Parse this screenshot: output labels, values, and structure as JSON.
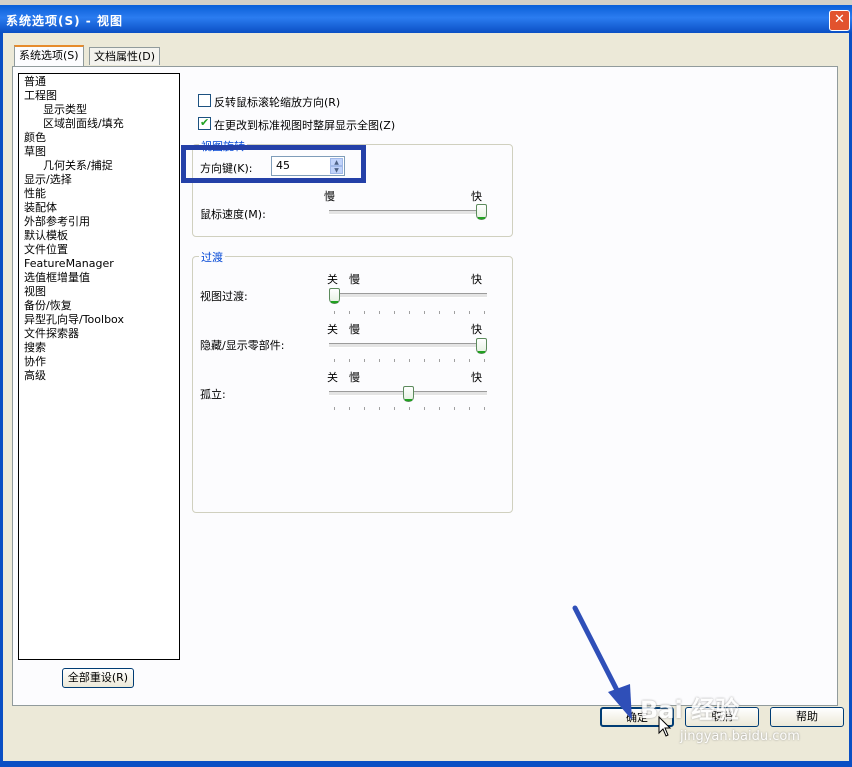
{
  "window": {
    "title": "系统选项(S) - 视图",
    "close_label": "✕"
  },
  "tabs": [
    {
      "label": "系统选项(S)",
      "active": true
    },
    {
      "label": "文档属性(D)",
      "active": false
    }
  ],
  "tree": {
    "items": [
      {
        "label": "普通",
        "level": 0
      },
      {
        "label": "工程图",
        "level": 0
      },
      {
        "label": "显示类型",
        "level": 1
      },
      {
        "label": "区域剖面线/填充",
        "level": 1
      },
      {
        "label": "颜色",
        "level": 0
      },
      {
        "label": "草图",
        "level": 0
      },
      {
        "label": "几何关系/捕捉",
        "level": 1
      },
      {
        "label": "显示/选择",
        "level": 0
      },
      {
        "label": "性能",
        "level": 0
      },
      {
        "label": "装配体",
        "level": 0
      },
      {
        "label": "外部参考引用",
        "level": 0
      },
      {
        "label": "默认模板",
        "level": 0
      },
      {
        "label": "文件位置",
        "level": 0
      },
      {
        "label": "FeatureManager",
        "level": 0
      },
      {
        "label": "选值框增量值",
        "level": 0
      },
      {
        "label": "视图",
        "level": 0
      },
      {
        "label": "备份/恢复",
        "level": 0
      },
      {
        "label": "异型孔向导/Toolbox",
        "level": 0
      },
      {
        "label": "文件探索器",
        "level": 0
      },
      {
        "label": "搜索",
        "level": 0
      },
      {
        "label": "协作",
        "level": 0
      },
      {
        "label": "高级",
        "level": 0
      }
    ],
    "reset_button": "全部重设(R)"
  },
  "options": {
    "reverse_wheel": {
      "label": "反转鼠标滚轮缩放方向(R)",
      "checked": false
    },
    "zoom_fit": {
      "label": "在更改到标准视图时整屏显示全图(Z)",
      "checked": true
    }
  },
  "view_rotation": {
    "group_title": "视图旋转",
    "arrow_keys_label": "方向键(K):",
    "arrow_keys_value": "45",
    "mouse_speed_label": "鼠标速度(M):",
    "slow": "慢",
    "fast": "快",
    "mouse_speed_level": 1.0
  },
  "transitions": {
    "group_title": "过渡",
    "off": "关",
    "slow": "慢",
    "fast": "快",
    "view_transition": {
      "label": "视图过渡:",
      "level": 0.0
    },
    "hide_show": {
      "label": "隐藏/显示零部件:",
      "level": 1.0
    },
    "isolate": {
      "label": "孤立:",
      "level": 0.5
    }
  },
  "footer": {
    "ok": "确定",
    "cancel": "取消",
    "help": "帮助"
  },
  "watermark": {
    "brand": "Bai 经验",
    "url": "jingyan.baidu.com"
  },
  "colors": {
    "title_bar": "#0a5fd8",
    "highlight": "#2440a8",
    "group_title": "#0046d5"
  }
}
